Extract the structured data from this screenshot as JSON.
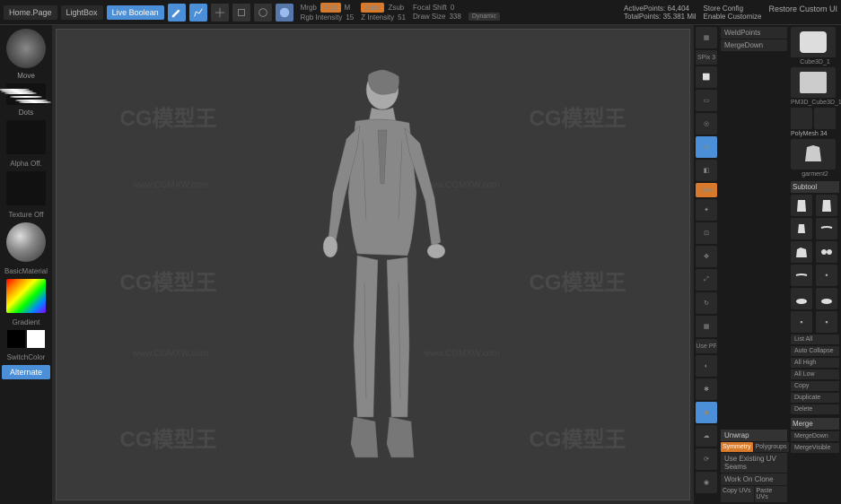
{
  "topbar": {
    "home": "Home.Page",
    "lightbox": "LightBox",
    "liveboolean": "Live Boolean",
    "edit": "Edit",
    "draw": "Draw",
    "move": "Move",
    "scale": "Scale",
    "rotate": "Rotate",
    "mrgb_label": "Mrgb",
    "rgb_btn": "Rgb",
    "m_label": "M",
    "rgb_intensity_label": "Rgb Intensity",
    "rgb_intensity_val": "15",
    "zadd_btn": "Zadd",
    "zsub_label": "Zsub",
    "z_intensity_label": "Z Intensity",
    "z_intensity_val": "51",
    "focal_label": "Focal Shift",
    "focal_val": "0",
    "drawsize_label": "Draw Size",
    "drawsize_val": "338",
    "dynamic": "Dynamic",
    "activepoints_label": "ActivePoints:",
    "activepoints_val": "64,404",
    "totalpoints_label": "TotalPoints:",
    "totalpoints_val": "35.381 Mil",
    "storeconfig": "Store Config",
    "enablecustomize": "Enable Customize",
    "restoreui": "Restore Custom UI"
  },
  "left": {
    "move": "Move",
    "dots": "Dots",
    "alpha_off": "Alpha Off.",
    "texture_off": "Texture Off",
    "basicmaterial": "BasicMaterial",
    "gradient": "Gradient",
    "switchcolor": "SwitchColor",
    "alternate": "Alternate"
  },
  "right_tools": {
    "weldpoints": "WeldPoints",
    "mergedown": "MergeDown",
    "spix": "SPix 3",
    "persp": "Persp",
    "floor": "Floor",
    "local": "Local",
    "frame": "Frame",
    "move": "Move",
    "scale": "Scale",
    "rotate": "Rotate",
    "geo": "Geo",
    "usepf": "Use PF"
  },
  "right_panel": {
    "unwrap": "Unwrap",
    "symmetry": "Symmetry",
    "polygroups": "Polygroups",
    "use_existing": "Use Existing UV Seams",
    "work_on_clone": "Work On Clone",
    "copy_uvs": "Copy UVs",
    "paste_uvs": "Paste UVs"
  },
  "far_right": {
    "cube3d": "Cube3D_1",
    "pm3d": "PM3D_Cube3D_1",
    "polymesh": "PolyMesh",
    "num34": "34",
    "garment2": "garment2",
    "subtool": "Subtool",
    "list_all": "List All",
    "auto_collapse": "Auto Collapse",
    "all_high": "All High",
    "all_low": "All Low",
    "copy": "Copy",
    "duplicate": "Duplicate",
    "delete": "Delete",
    "merge": "Merge",
    "mergedown": "MergeDown",
    "mergevisible": "MergeVisible"
  },
  "watermarks": {
    "main": "CG模型王",
    "url": "www.CGMXW.com"
  }
}
